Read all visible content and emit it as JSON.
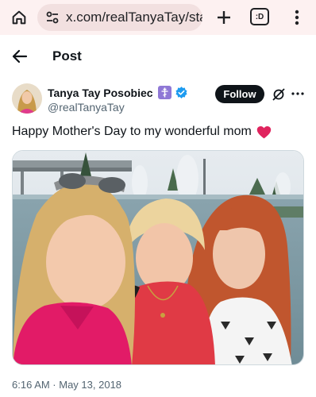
{
  "browser": {
    "url": "x.com/realTanyaTay/statu",
    "tabs_count": ":D"
  },
  "page": {
    "title": "Post"
  },
  "author": {
    "name": "Tanya Tay Posobiec",
    "handle": "@realTanyaTay",
    "follow_label": "Follow"
  },
  "tweet": {
    "text": "Happy Mother's Day to my wonderful mom",
    "timestamp": "6:16 AM · May 13, 2018"
  },
  "colors": {
    "follow_bg": "#0f1419",
    "verified_blue": "#1d9bf0",
    "heart_red": "#e0245e",
    "secondary_text": "#536471"
  }
}
